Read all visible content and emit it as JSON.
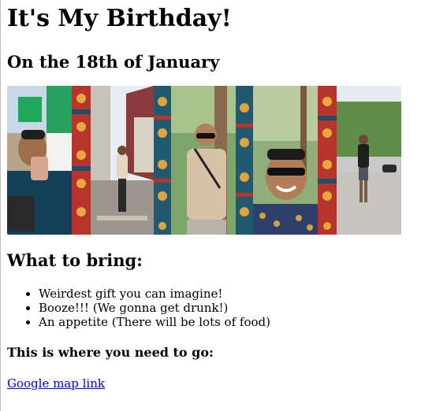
{
  "title": "It's My Birthday!",
  "subtitle": "On the 18th of January",
  "bring": {
    "heading": "What to bring:",
    "items": [
      "Weirdest gift you can imagine!",
      "Booze!!! (We gonna get drunk!)",
      "An appetite (There will be lots of food)"
    ]
  },
  "location": {
    "heading": "This is where you need to go:",
    "link_label": "Google map link"
  }
}
